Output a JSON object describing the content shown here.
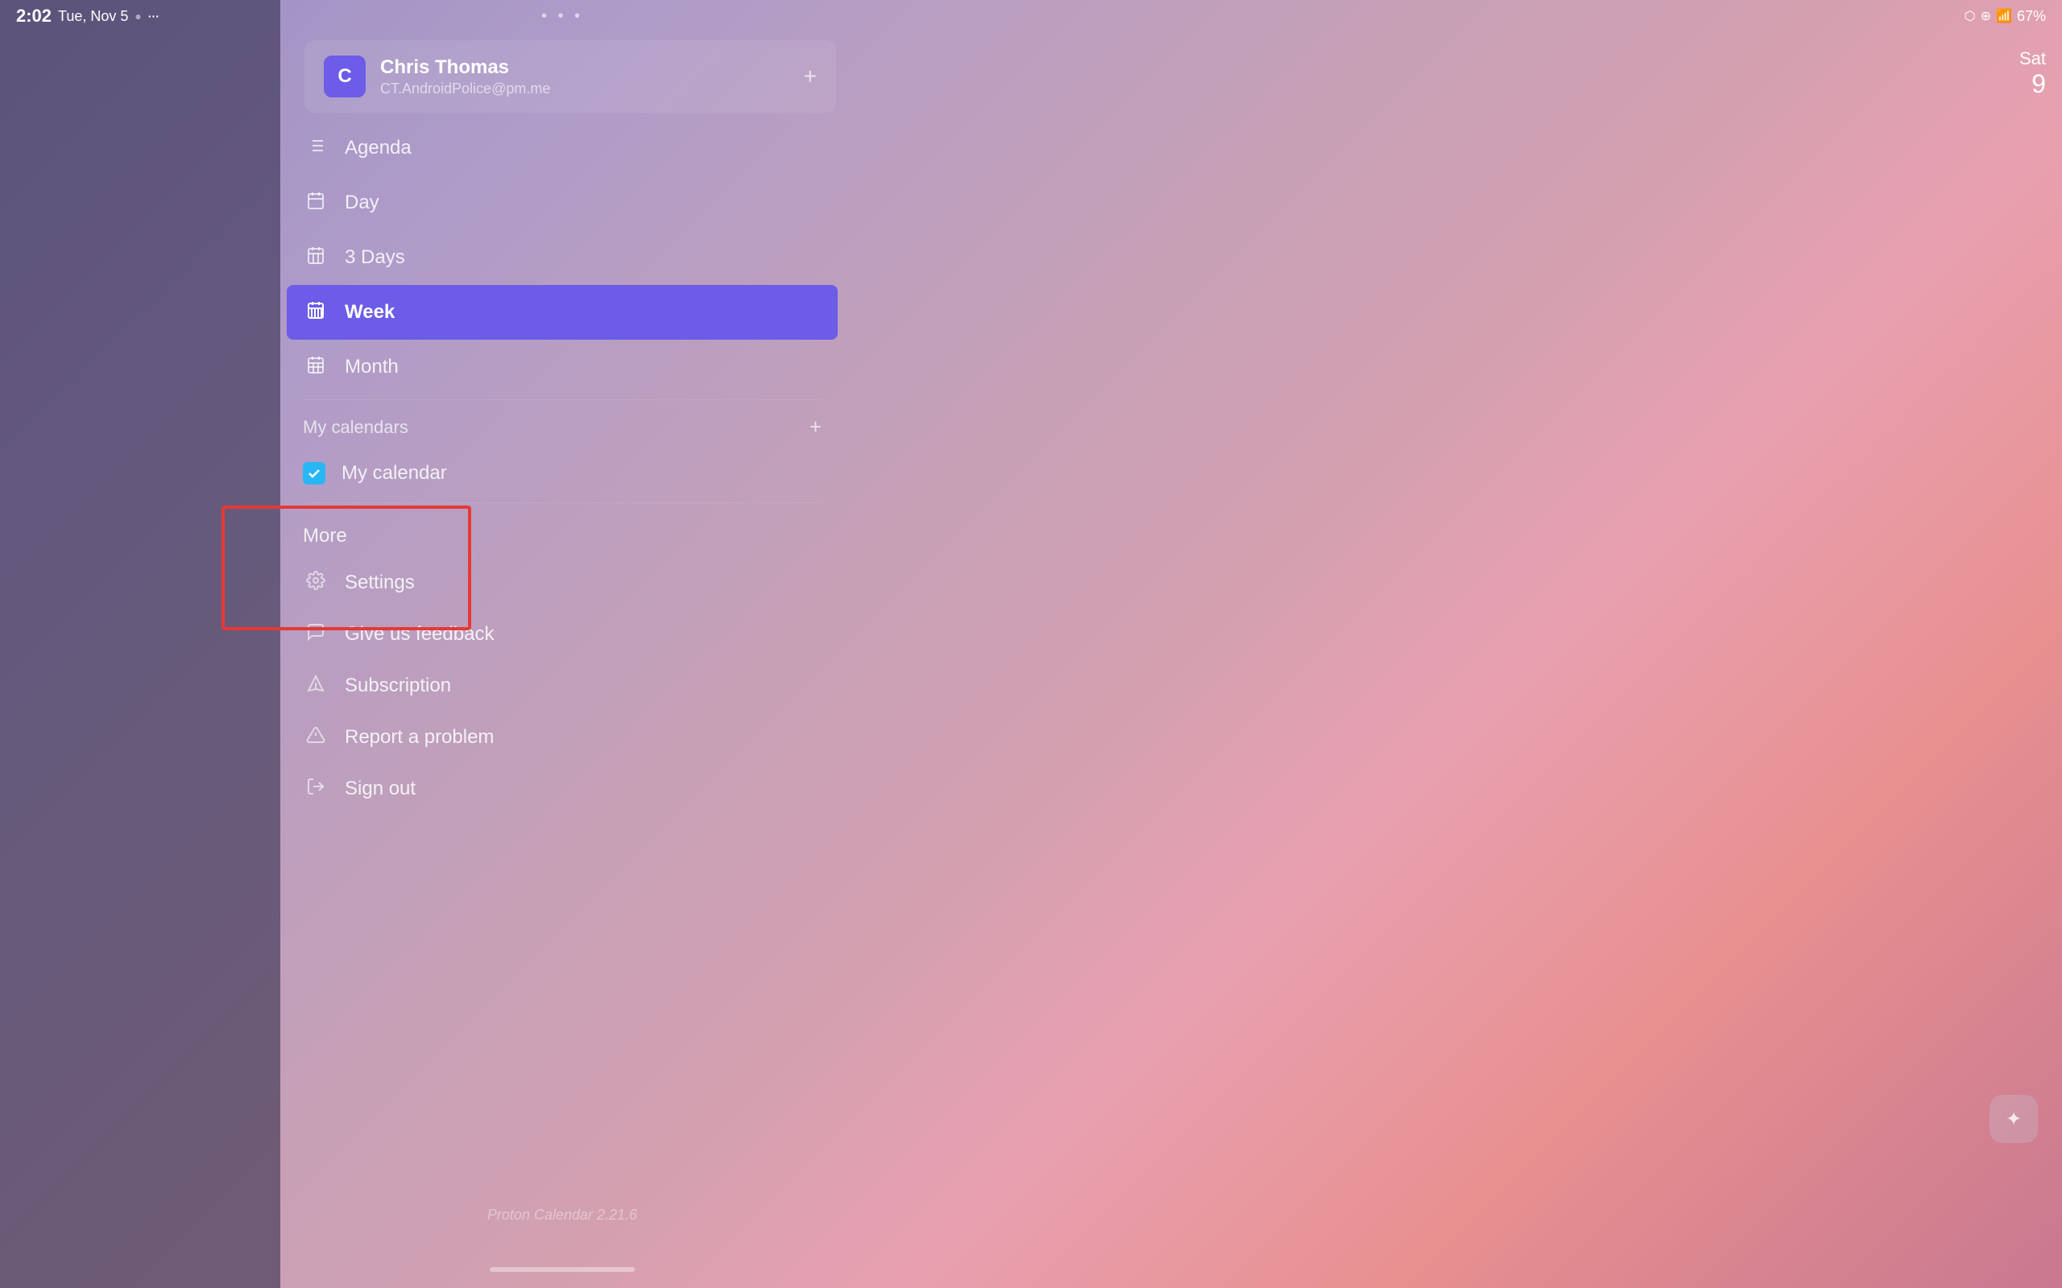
{
  "statusBar": {
    "time": "2:02",
    "date": "Tue, Nov 5",
    "batteryPercent": "67",
    "batteryIcon": "🔋"
  },
  "topDots": "• • •",
  "account": {
    "initial": "C",
    "name": "Chris Thomas",
    "email": "CT.AndroidPolice@pm.me",
    "addLabel": "+"
  },
  "dateIndicator": {
    "day": "Sat",
    "num": "9"
  },
  "navItems": [
    {
      "icon": "≡",
      "label": "Agenda",
      "active": false
    },
    {
      "icon": "☐",
      "label": "Day",
      "active": false
    },
    {
      "icon": "▦",
      "label": "3 Days",
      "active": false
    },
    {
      "icon": "▥",
      "label": "Week",
      "active": true
    },
    {
      "icon": "▦",
      "label": "Month",
      "active": false
    }
  ],
  "calendarsSection": {
    "title": "My calendars",
    "addLabel": "+",
    "items": [
      {
        "label": "My calendar",
        "checked": true,
        "color": "#29b6f6"
      }
    ]
  },
  "moreSection": {
    "title": "More",
    "items": [
      {
        "icon": "⚙",
        "label": "Settings"
      },
      {
        "icon": "💬",
        "label": "Give us feedback"
      },
      {
        "icon": "✏",
        "label": "Subscription"
      },
      {
        "icon": "⚠",
        "label": "Report a problem"
      },
      {
        "icon": "↩",
        "label": "Sign out"
      }
    ]
  },
  "versionText": "Proton Calendar 2.21.6",
  "widgetIcon": "✦"
}
